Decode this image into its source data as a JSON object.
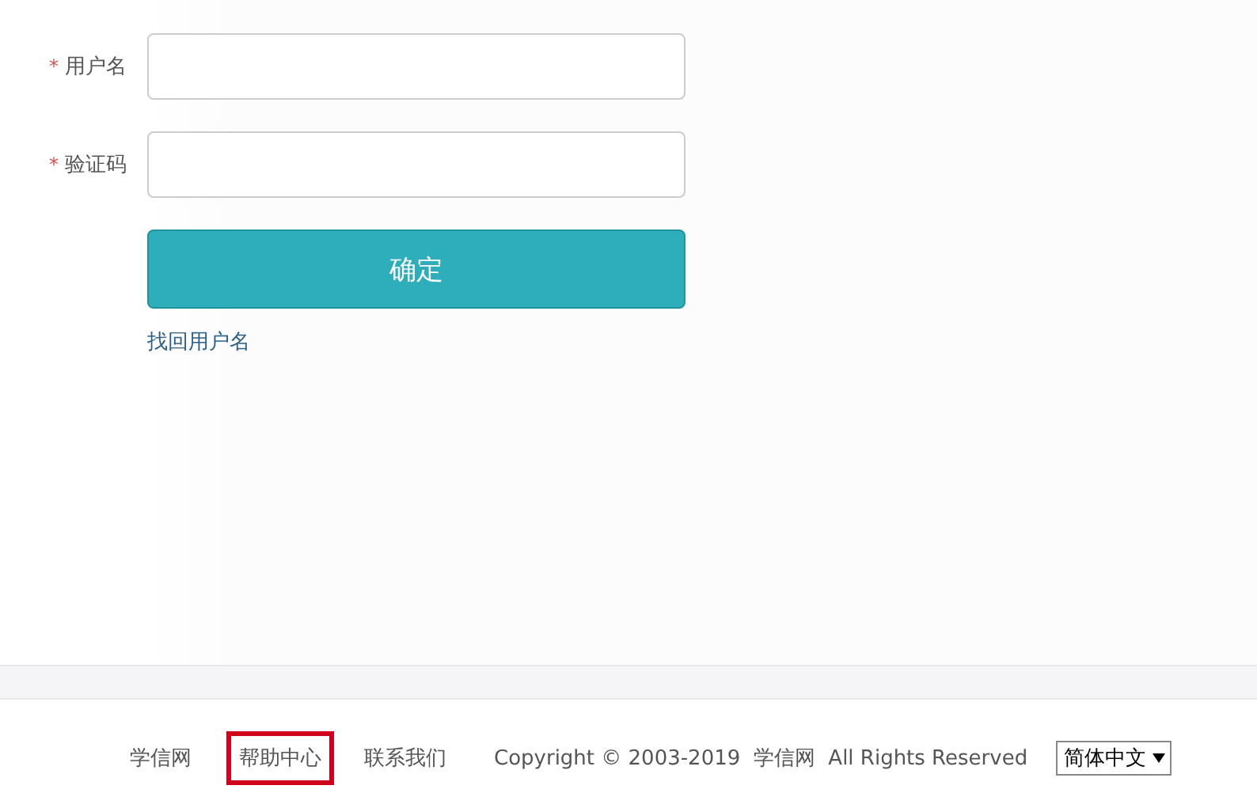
{
  "form": {
    "fields": [
      {
        "mark": "*",
        "label": "用户名"
      },
      {
        "mark": "*",
        "label": "验证码"
      }
    ],
    "submit": "确定",
    "link": "找回用户名"
  },
  "footer": {
    "links": [
      {
        "label": "学信网",
        "highlighted": false
      },
      {
        "label": "帮助中心",
        "highlighted": true
      },
      {
        "label": "联系我们",
        "highlighted": false
      }
    ],
    "copyright": "Copyright © 2003-2019  学信网  All Rights Reserved",
    "language": "简体中文"
  }
}
